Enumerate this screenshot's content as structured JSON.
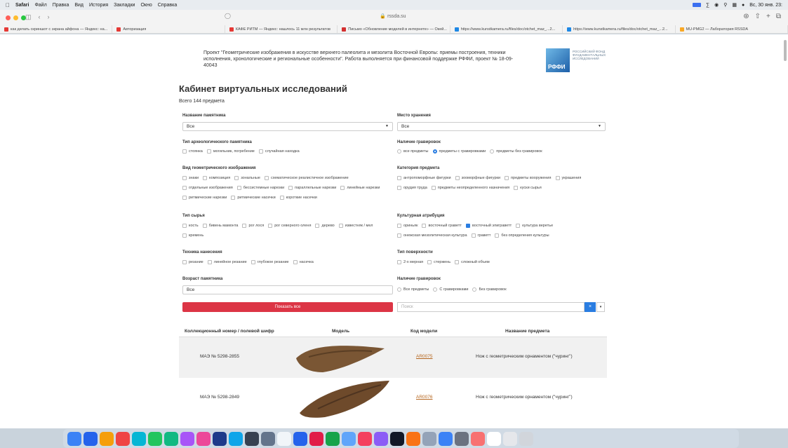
{
  "menubar": {
    "app": "Safari",
    "items": [
      "Файл",
      "Правка",
      "Вид",
      "История",
      "Закладки",
      "Окно",
      "Справка"
    ],
    "clock": "Вс, 30 янв. 23:"
  },
  "browser": {
    "address": "rssda.su",
    "tabs": [
      {
        "label": "как делать скриншот с экрана айфона — Яндекс: на...",
        "color": "#e53935"
      },
      {
        "label": "Авторизация",
        "color": "#e53935"
      },
      {
        "label": "КАФЕ РИТМ — Яндекс: нашлось 11 млн результатов",
        "color": "#e53935"
      },
      {
        "label": "Письмо «Обновление моделей в интернете» — Окей...",
        "color": "#d32f2f"
      },
      {
        "label": "https://www.kunstkamera.ru/files/doc/otchet_maz_...2...",
        "color": "#1e88e5"
      },
      {
        "label": "https://www.kunstkamera.ru/files/doc/otchet_maz_...2...",
        "color": "#1e88e5"
      },
      {
        "label": "MU-PMG2 — Лаборатория RSSDA",
        "color": "#f9a825"
      }
    ]
  },
  "project": {
    "text": "Проект \"Геометрические изображения в искусстве верхнего палеолита и мезолита Восточной Европы: приемы построения, техники исполнения, хронологические и региональные особенности\". Работа выполняется при финансовой поддержке РФФИ, проект № 18-09-40043",
    "logo_abbr": "РФФИ",
    "logo_text": "РОССИЙСКИЙ ФОНД ФУНДАМЕНТАЛЬНЫХ ИССЛЕДОВАНИЙ"
  },
  "title": "Кабинет виртуальных исследований",
  "total": "Всего 144 предмета",
  "filters": {
    "monument_name": {
      "label": "Название памятника",
      "value": "Все"
    },
    "storage": {
      "label": "Место хранения",
      "value": "Все"
    },
    "site_type": {
      "label": "Тип археологического памятника",
      "options": [
        "стоянка",
        "могильник, погребение",
        "случайная находка"
      ]
    },
    "engravings": {
      "label": "Наличие гравировок",
      "options": [
        "все предметы",
        "предметы с гравировками",
        "предметы без гравировок"
      ],
      "selected": 1
    },
    "geom_type": {
      "label": "Вид геометрического изображения",
      "options": [
        "знаки",
        "композиция",
        "зональные",
        "схематическое реалистичное изображение",
        "отдельные изображения",
        "бессистемные нарезки",
        "параллельные нарезки",
        "линейные нарезки",
        "ритмические нарезки",
        "ритмические насечки",
        "короткие насечки"
      ]
    },
    "category": {
      "label": "Категория предмета",
      "options": [
        "антропоморфные фигурки",
        "зооморфные фигурки",
        "предметы вооружения",
        "украшения",
        "орудия труда",
        "предметы неопределенного назначения",
        "куски сырья"
      ]
    },
    "material": {
      "label": "Тип сырья",
      "options": [
        "кость",
        "бивень мамонта",
        "рог лося",
        "рог северного оленя",
        "дерево",
        "известняк / мел",
        "кремень"
      ]
    },
    "culture": {
      "label": "Культурная атрибуция",
      "options": [
        "ориньяк",
        "восточный граветт",
        "восточный эпиграветт",
        "культура веретье",
        "онежская мезолитическая культура",
        "граветт",
        "без определения культуры"
      ],
      "checked": 2
    },
    "technique": {
      "label": "Техника нанесения",
      "options": [
        "резание",
        "линейное резание",
        "глубокое резание",
        "насечка"
      ]
    },
    "surface": {
      "label": "Тип поверхности",
      "options": [
        "2-х мерная",
        "стержень",
        "сложный объем"
      ]
    },
    "age": {
      "label": "Возраст памятника",
      "value": "Все"
    },
    "engravings2": {
      "label": "Наличие гравировок",
      "options": [
        "Все предметы",
        "С гравировками",
        "Без гравировок"
      ]
    }
  },
  "actions": {
    "show_all": "Показать все",
    "search_placeholder": "Поиск",
    "clear": "×",
    "caret": "▾"
  },
  "table": {
    "headers": [
      "Коллекционный номер / полевой шифр",
      "Модель",
      "Код модели",
      "Название предмета"
    ],
    "rows": [
      {
        "number": "МАЭ № 5298-2855",
        "code": "AR0075",
        "name": "Нож с геометрическим орнаментом (\"чуринг\")"
      },
      {
        "number": "МАЭ № 5298-2849",
        "code": "AR0076",
        "name": "Нож с геометрическим орнаментом (\"чуринг\")"
      }
    ]
  }
}
